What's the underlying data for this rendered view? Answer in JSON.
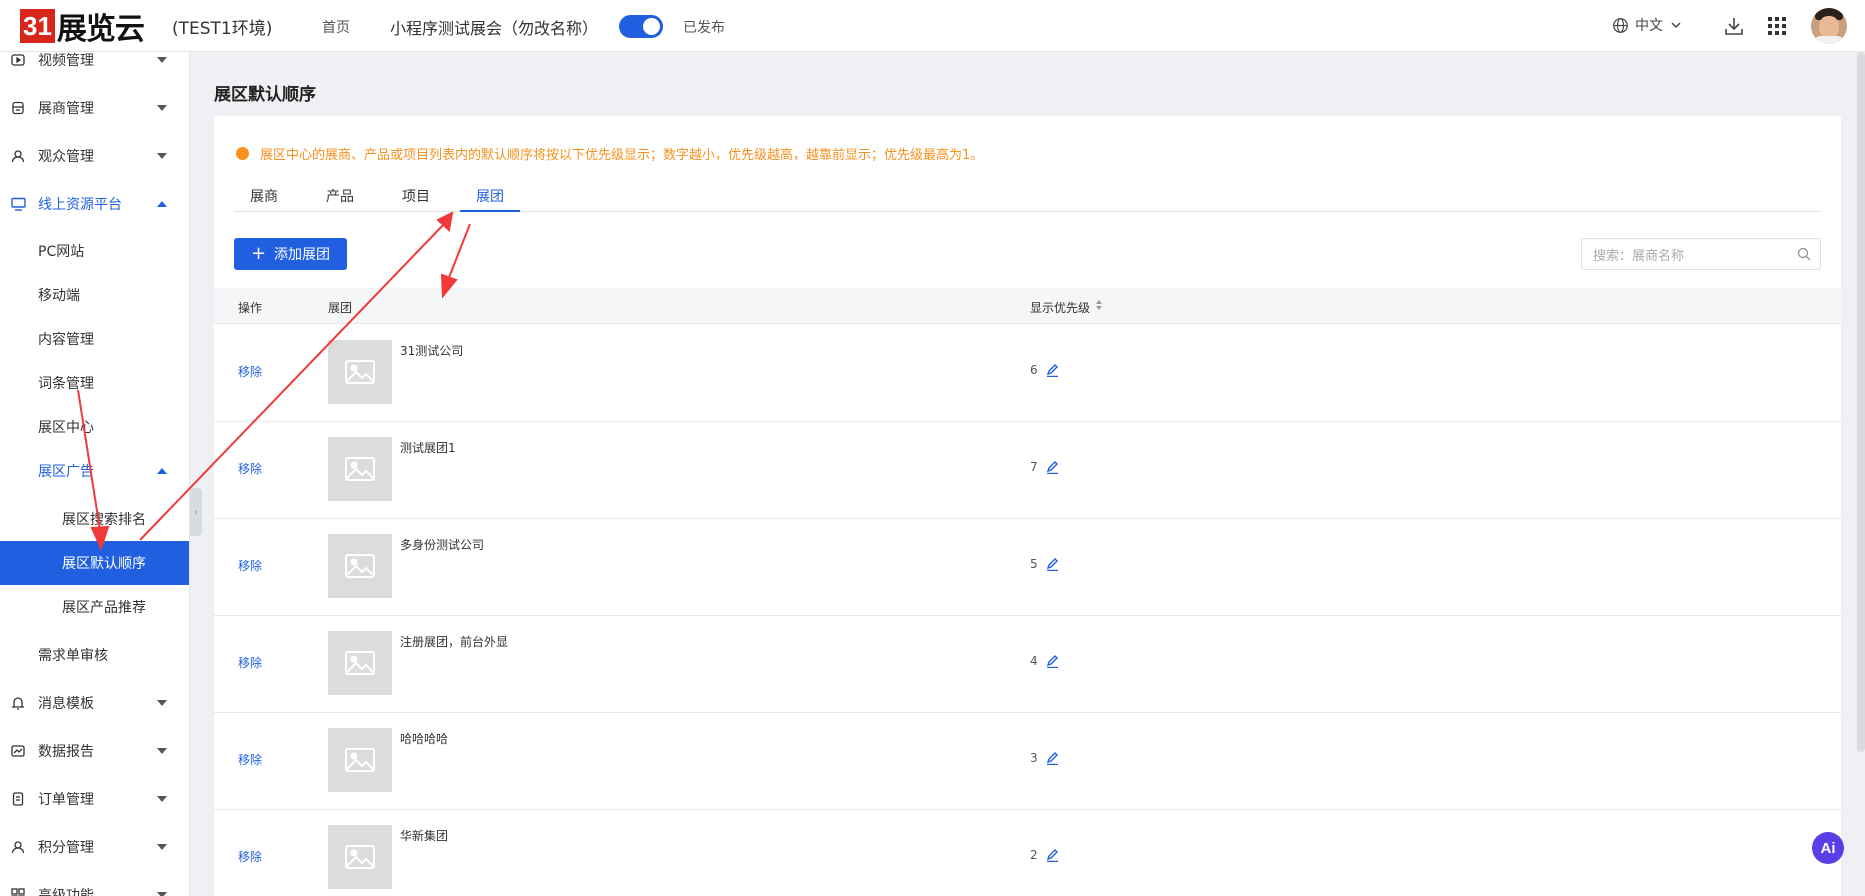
{
  "header": {
    "logo_box": "31",
    "logo_text": "展览云",
    "env": "(TEST1环境)",
    "home": "首页",
    "expo_name": "小程序测试展会（勿改名称）",
    "publish_status": "已发布",
    "language": "中文",
    "toggle_on": true
  },
  "sidebar": {
    "items": [
      {
        "label": "视频管理"
      },
      {
        "label": "展商管理"
      },
      {
        "label": "观众管理"
      },
      {
        "label": "线上资源平台"
      },
      {
        "label": "PC网站"
      },
      {
        "label": "移动端"
      },
      {
        "label": "内容管理"
      },
      {
        "label": "词条管理"
      },
      {
        "label": "展区中心"
      },
      {
        "label": "展区广告"
      },
      {
        "label": "展区搜索排名"
      },
      {
        "label": "展区默认顺序"
      },
      {
        "label": "展区产品推荐"
      },
      {
        "label": "需求单审核"
      },
      {
        "label": "消息模板"
      },
      {
        "label": "数据报告"
      },
      {
        "label": "订单管理"
      },
      {
        "label": "积分管理"
      },
      {
        "label": "高级功能"
      }
    ]
  },
  "main": {
    "page_title": "展区默认顺序",
    "notice": "展区中心的展商、产品或项目列表内的默认顺序将按以下优先级显示；数字越小，优先级越高，越靠前显示；优先级最高为1。",
    "tabs": [
      {
        "label": "展商"
      },
      {
        "label": "产品"
      },
      {
        "label": "项目"
      },
      {
        "label": "展团"
      }
    ],
    "add_button": "添加展团",
    "search_placeholder": "搜索：展商名称",
    "table": {
      "headers": {
        "action": "操作",
        "group": "展团",
        "priority": "显示优先级"
      },
      "rows": [
        {
          "action": "移除",
          "name": "31测试公司",
          "priority": "6"
        },
        {
          "action": "移除",
          "name": "测试展团1",
          "priority": "7"
        },
        {
          "action": "移除",
          "name": "多身份测试公司",
          "priority": "5"
        },
        {
          "action": "移除",
          "name": "注册展团，前台外显",
          "priority": "4"
        },
        {
          "action": "移除",
          "name": "哈哈哈哈",
          "priority": "3"
        },
        {
          "action": "移除",
          "name": "华新集团",
          "priority": "2"
        }
      ]
    }
  },
  "ai_button": "Ai",
  "colors": {
    "accent": "#1f5fe0",
    "notice": "#f7901e",
    "logo": "#d9261c",
    "annotation": "#f03a3a"
  }
}
